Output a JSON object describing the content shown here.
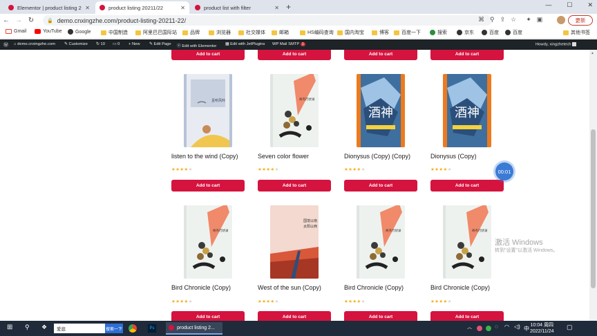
{
  "tabs": [
    {
      "label": "Elementor | product listing 20",
      "color": "#d5133f"
    },
    {
      "label": "product listing 20211/22",
      "color": "#d5133f"
    },
    {
      "label": "product list with filter",
      "color": "#d5133f"
    }
  ],
  "window": {
    "minimize": "—",
    "maximize": "☐",
    "close": "✕"
  },
  "address": {
    "url": "demo.cnxingzhe.com/product-listing-20211-22/",
    "update_label": "更新"
  },
  "bookmarks": [
    {
      "label": "Gmail",
      "icon": "gmail-icon"
    },
    {
      "label": "YouTube",
      "icon": "youtube-icon"
    },
    {
      "label": "Google",
      "icon": "globe-icon"
    },
    {
      "label": "中国制造",
      "icon": "folder-icon"
    },
    {
      "label": "阿里巴巴国际站",
      "icon": "folder-icon"
    },
    {
      "label": "品牌",
      "icon": "folder-icon"
    },
    {
      "label": "浏览器",
      "icon": "folder-icon"
    },
    {
      "label": "社交媒体",
      "icon": "folder-icon"
    },
    {
      "label": "邮箱",
      "icon": "folder-icon"
    },
    {
      "label": "HS编码查询",
      "icon": "folder-icon"
    },
    {
      "label": "国内淘宝",
      "icon": "folder-icon"
    },
    {
      "label": "博客",
      "icon": "folder-icon"
    },
    {
      "label": "百度一下",
      "icon": "folder-icon"
    },
    {
      "label": "搜索",
      "icon": "search-icon"
    },
    {
      "label": "京东",
      "icon": "globe-icon"
    },
    {
      "label": "百度",
      "icon": "globe-icon"
    },
    {
      "label": "百度",
      "icon": "globe-icon"
    },
    {
      "label": "其他书签",
      "icon": "folder-icon"
    }
  ],
  "wpbar": {
    "site": "demo.cnxingzhe.com",
    "customize": "Customize",
    "updates": "10",
    "comments": "0",
    "new": "+ New",
    "edit_page": "Edit Page",
    "elementor": "Edit with Elementor",
    "jetplugins": "Edit with JetPlugins",
    "smtp": "WP Mail SMTP",
    "smtp_badge": "1",
    "howdy": "Howdy, xingzhetech"
  },
  "add_to_cart": "Add to cart",
  "products": [
    {
      "name": "listen to the wind (Copy)",
      "rating": 4,
      "cover": "wind"
    },
    {
      "name": "Seven color flower",
      "rating": 4,
      "cover": "bird"
    },
    {
      "name": "Dionysus (Copy) (Copy)",
      "rating": 4,
      "cover": "dionysus"
    },
    {
      "name": "Dionysus (Copy)",
      "rating": 4,
      "cover": "dionysus"
    },
    {
      "name": "Bird Chronicle (Copy)",
      "rating": 4,
      "cover": "bird"
    },
    {
      "name": "West of the sun (Copy)",
      "rating": 4,
      "cover": "west"
    },
    {
      "name": "Bird Chronicle (Copy)",
      "rating": 4,
      "cover": "bird"
    },
    {
      "name": "Bird Chronicle (Copy)",
      "rating": 4,
      "cover": "bird"
    }
  ],
  "timer": "00:01",
  "watermark": {
    "line1": "激活 Windows",
    "line2": "转到\"设置\"以激活 Windows。"
  },
  "taskbar": {
    "search_text": "爱逛",
    "search_button": "搜索一下",
    "app_label": "product listing 2...",
    "time": "10:04 周四",
    "date": "2022/11/24",
    "ime": "中"
  }
}
